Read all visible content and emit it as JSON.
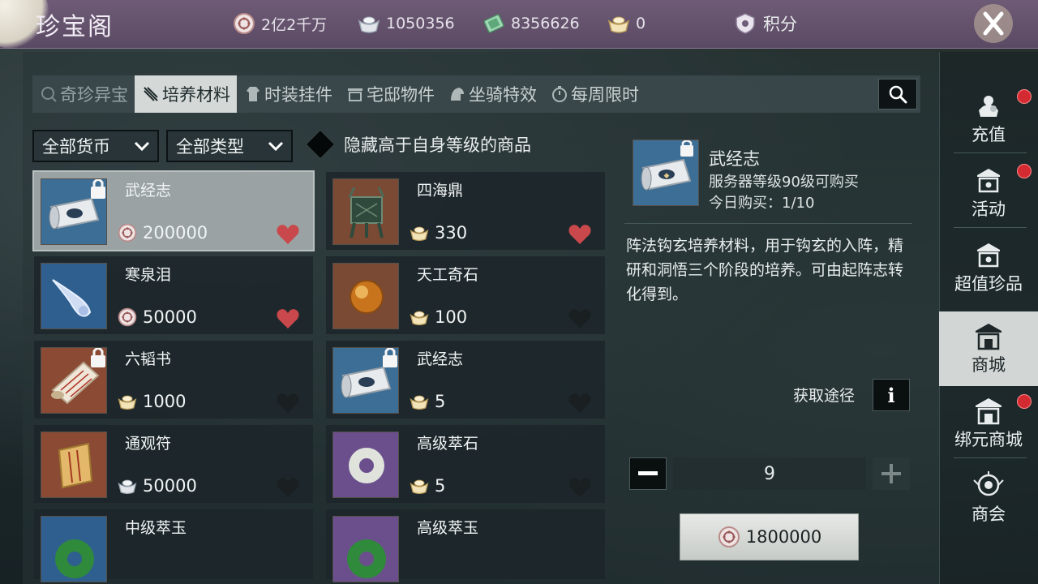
{
  "app": {
    "title": "珍宝阁"
  },
  "currencies": [
    {
      "icon": "coin-icon",
      "value": "2亿2千万"
    },
    {
      "icon": "silver-ingot-icon",
      "value": "1050356"
    },
    {
      "icon": "jade-ticket-icon",
      "value": "8356626"
    },
    {
      "icon": "gold-ingot-icon",
      "value": "0"
    }
  ],
  "points": {
    "label": "积分"
  },
  "tabs": [
    {
      "label": "奇珍异宝",
      "icon": "treasure-icon",
      "active": false
    },
    {
      "label": "培养材料",
      "icon": "material-icon",
      "active": true
    },
    {
      "label": "时装挂件",
      "icon": "fashion-icon",
      "active": false
    },
    {
      "label": "宅邸物件",
      "icon": "house-icon",
      "active": false
    },
    {
      "label": "坐骑特效",
      "icon": "mount-icon",
      "active": false
    },
    {
      "label": "每周限时",
      "icon": "timer-icon",
      "active": false
    }
  ],
  "filters": {
    "currency": "全部货币",
    "type": "全部类型",
    "hide_label": "隐藏高于自身等级的商品"
  },
  "items": [
    {
      "name": "武经志",
      "price": "200000",
      "currency": "coin",
      "locked": true,
      "favorite": true,
      "selected": true,
      "art": "scroll"
    },
    {
      "name": "四海鼎",
      "price": "330",
      "currency": "ingot",
      "locked": false,
      "favorite": true,
      "selected": false,
      "art": "cauldron"
    },
    {
      "name": "寒泉泪",
      "price": "50000",
      "currency": "coin",
      "locked": false,
      "favorite": true,
      "selected": false,
      "art": "tear"
    },
    {
      "name": "天工奇石",
      "price": "100",
      "currency": "ingot",
      "locked": false,
      "favorite": false,
      "selected": false,
      "art": "orb"
    },
    {
      "name": "六韬书",
      "price": "1000",
      "currency": "ingot",
      "locked": true,
      "favorite": false,
      "selected": false,
      "art": "book"
    },
    {
      "name": "武经志",
      "price": "5",
      "currency": "ingot",
      "locked": true,
      "favorite": false,
      "selected": false,
      "art": "scroll"
    },
    {
      "name": "通观符",
      "price": "50000",
      "currency": "silver",
      "locked": false,
      "favorite": false,
      "selected": false,
      "art": "talisman"
    },
    {
      "name": "高级萃石",
      "price": "5",
      "currency": "ingot",
      "locked": false,
      "favorite": false,
      "selected": false,
      "art": "ring-white"
    },
    {
      "name": "中级萃玉",
      "price": "",
      "currency": "",
      "locked": false,
      "favorite": false,
      "selected": false,
      "art": "ring-green"
    },
    {
      "name": "高级萃玉",
      "price": "",
      "currency": "",
      "locked": false,
      "favorite": false,
      "selected": false,
      "art": "ring-green-purple"
    }
  ],
  "detail": {
    "name": "武经志",
    "requirement": "服务器等级90级可购买",
    "limit": "今日购买：1/10",
    "description": "阵法钩玄培养材料，用于钩玄的入阵，精研和洞悟三个阶段的培养。可由起阵志转化得到。",
    "acquire_label": "获取途径",
    "quantity": "9",
    "total_price": "1800000"
  },
  "sidebar": [
    {
      "label": "充值",
      "icon": "recharge-icon",
      "badge": true,
      "active": false
    },
    {
      "label": "活动",
      "icon": "event-icon",
      "badge": true,
      "active": false
    },
    {
      "label": "超值珍品",
      "icon": "deal-icon",
      "badge": false,
      "active": false
    },
    {
      "label": "商城",
      "icon": "mall-icon",
      "badge": false,
      "active": true
    },
    {
      "label": "绑元商城",
      "icon": "bound-mall-icon",
      "badge": true,
      "active": false
    },
    {
      "label": "商会",
      "icon": "guild-shop-icon",
      "badge": false,
      "active": false
    }
  ],
  "colors": {
    "heart_active": "#c9484c",
    "heart_inactive": "#1a2022",
    "badge": "#d42a32"
  }
}
